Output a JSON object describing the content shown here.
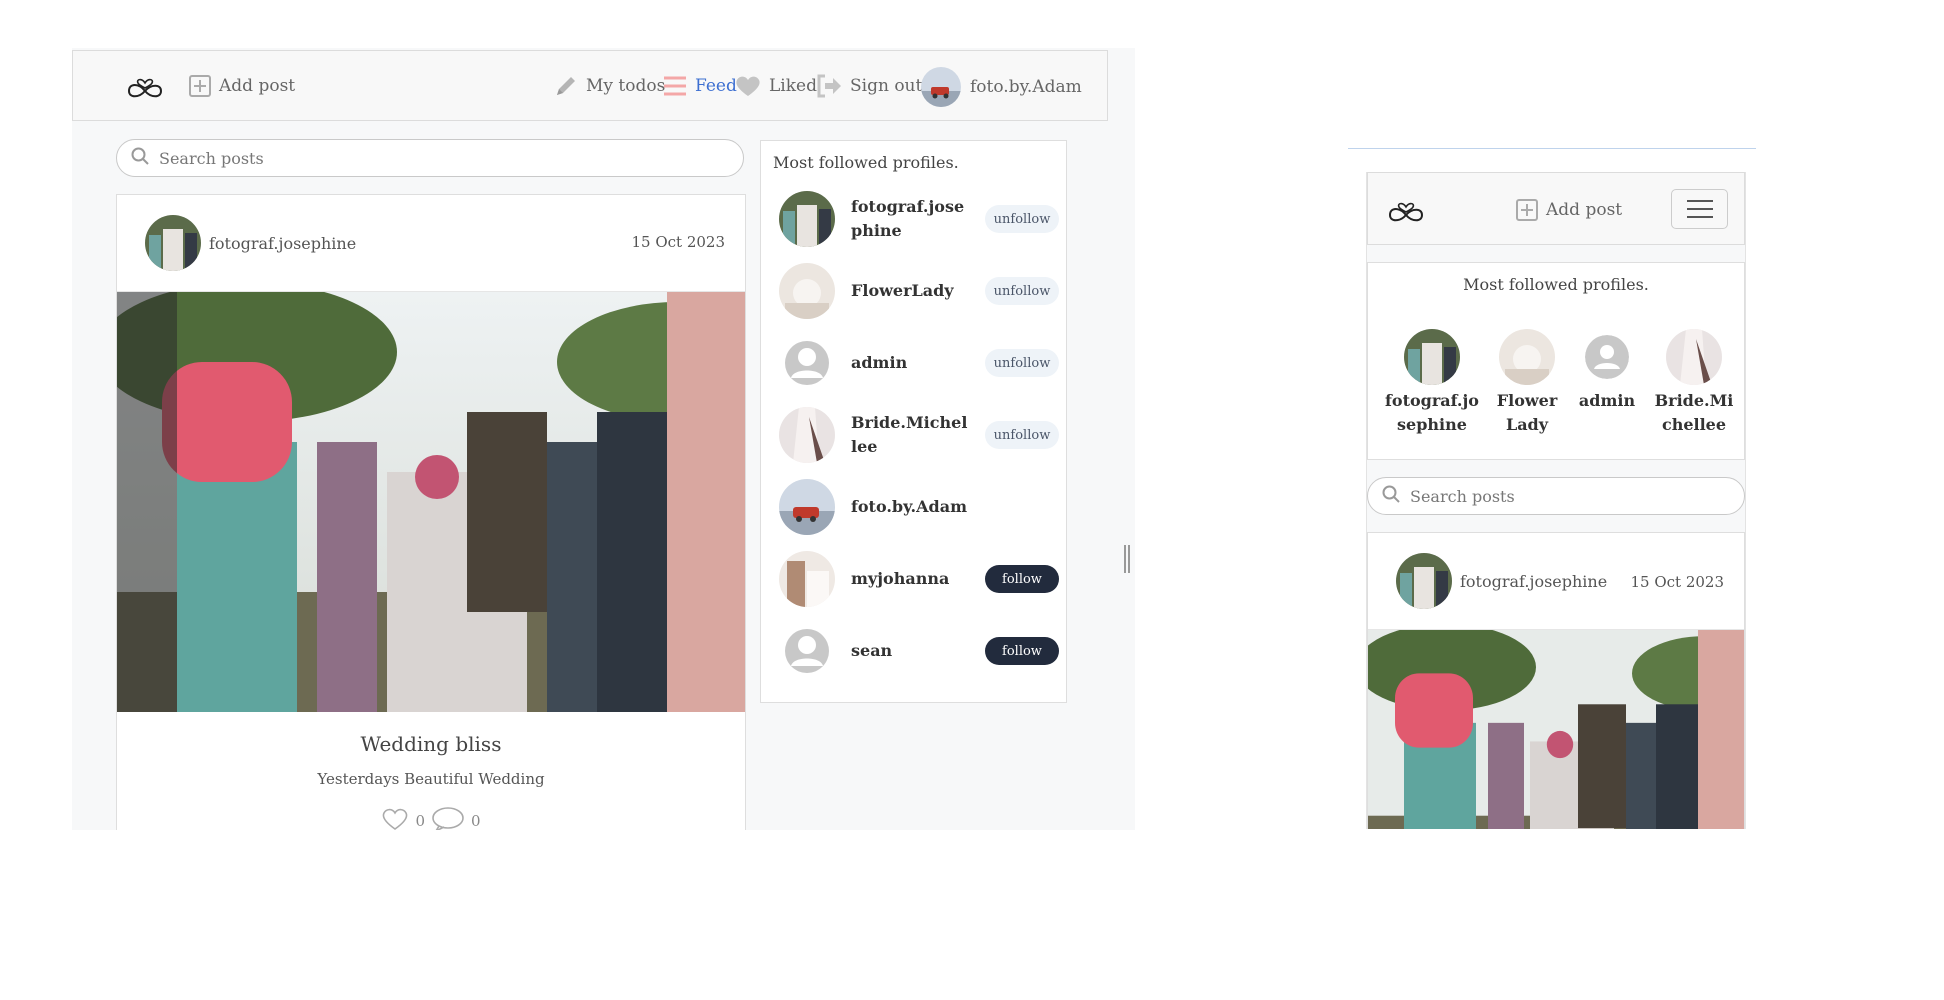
{
  "desktop": {
    "nav": {
      "add_post": "Add post",
      "my_todos": "My todos",
      "feed": "Feed",
      "liked": "Liked",
      "sign_out": "Sign out",
      "username": "foto.by.Adam"
    },
    "search": {
      "placeholder": "Search posts"
    },
    "post": {
      "author": "fotograf.josephine",
      "date": "15 Oct 2023",
      "title": "Wedding bliss",
      "description": "Yesterdays Beautiful Wedding",
      "likes": "0",
      "comments": "0"
    },
    "profiles": {
      "title": "Most followed profiles.",
      "items": [
        {
          "name": "fotograf.josephine",
          "action": "unfollow"
        },
        {
          "name": "FlowerLady",
          "action": "unfollow"
        },
        {
          "name": "admin",
          "action": "unfollow"
        },
        {
          "name": "Bride.Michellee",
          "action": "unfollow"
        },
        {
          "name": "foto.by.Adam",
          "action": ""
        },
        {
          "name": "myjohanna",
          "action": "follow"
        },
        {
          "name": "sean",
          "action": "follow"
        }
      ]
    }
  },
  "mobile": {
    "nav": {
      "add_post": "Add post"
    },
    "profiles": {
      "title": "Most followed profiles.",
      "items": [
        {
          "name": "fotograf.josephine"
        },
        {
          "name": "FlowerLady"
        },
        {
          "name": "admin"
        },
        {
          "name": "Bride.Michellee"
        }
      ]
    },
    "search": {
      "placeholder": "Search posts"
    },
    "post": {
      "author": "fotograf.josephine",
      "date": "15 Oct 2023"
    }
  },
  "colors": {
    "accent": "#3d6fd1",
    "follow_button": "#222b3d",
    "unfollow_button": "#eef3f8",
    "feed_icon": "#f4a7a7"
  },
  "icons": [
    "infinity-heart-logo",
    "plus-square-icon",
    "pencil-icon",
    "feed-lines-icon",
    "heart-icon",
    "sign-out-icon",
    "search-icon",
    "comment-icon",
    "menu-icon"
  ]
}
